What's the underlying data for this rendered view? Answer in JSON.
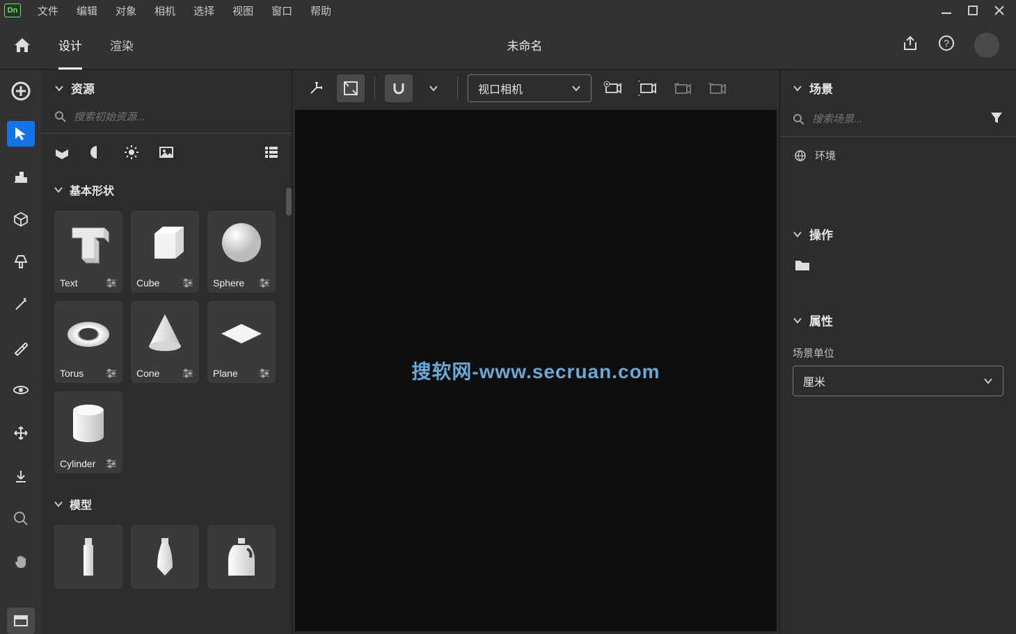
{
  "app_logo_text": "Dn",
  "menus": [
    "文件",
    "编辑",
    "对象",
    "相机",
    "选择",
    "视图",
    "窗口",
    "帮助"
  ],
  "tabs": {
    "home_icon": "home",
    "design": "设计",
    "render": "渲染",
    "active": "design"
  },
  "document_title": "未命名",
  "assets_panel": {
    "title": "资源",
    "search_placeholder": "搜索初始资源...",
    "section_basic_shapes": "基本形状",
    "section_models": "模型",
    "shapes": [
      {
        "label": "Text"
      },
      {
        "label": "Cube"
      },
      {
        "label": "Sphere"
      },
      {
        "label": "Torus"
      },
      {
        "label": "Cone"
      },
      {
        "label": "Plane"
      },
      {
        "label": "Cylinder"
      }
    ]
  },
  "viewport": {
    "camera_dropdown": "视口相机",
    "watermark": "搜软网-www.secruan.com"
  },
  "scene_panel": {
    "title": "场景",
    "search_placeholder": "搜索场景...",
    "items": [
      {
        "label": "环境"
      }
    ],
    "actions_title": "操作",
    "properties_title": "属性",
    "scene_units_label": "场景单位",
    "scene_units_value": "厘米"
  }
}
